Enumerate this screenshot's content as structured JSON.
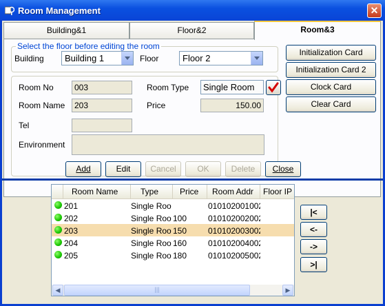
{
  "window": {
    "title": "Room Management"
  },
  "tabs": [
    {
      "label": "Building&1",
      "active": false
    },
    {
      "label": "Floor&2",
      "active": false
    },
    {
      "label": "Room&3",
      "active": true
    }
  ],
  "floor_group": {
    "legend": "Select the floor before editing the room",
    "building_label": "Building",
    "building_value": "Building 1",
    "floor_label": "Floor",
    "floor_value": "Floor 2"
  },
  "room_form": {
    "room_no_label": "Room No",
    "room_no_value": "003",
    "room_type_label": "Room Type",
    "room_type_value": "Single Room",
    "room_name_label": "Room Name",
    "room_name_value": "203",
    "price_label": "Price",
    "price_value": "150.00",
    "tel_label": "Tel",
    "tel_value": "",
    "environment_label": "Environment",
    "environment_value": ""
  },
  "card_buttons": [
    "Initialization Card",
    "Initialization Card 2",
    "Clock Card",
    "Clear Card"
  ],
  "action_buttons": {
    "add": "Add",
    "edit": "Edit",
    "cancel": "Cancel",
    "ok": "OK",
    "delete": "Delete",
    "close": "Close"
  },
  "grid": {
    "columns": [
      "Room Name",
      "Type",
      "Price",
      "Room Addr",
      "Floor IP"
    ],
    "rows": [
      {
        "name": "201",
        "type": "Single Room",
        "price": "",
        "addr": "010102001002",
        "ip": "",
        "selected": false
      },
      {
        "name": "202",
        "type": "Single Room",
        "price": "100",
        "addr": "010102002002",
        "ip": "",
        "selected": false
      },
      {
        "name": "203",
        "type": "Single Room",
        "price": "150",
        "addr": "010102003002",
        "ip": "",
        "selected": true
      },
      {
        "name": "204",
        "type": "Single Room",
        "price": "160",
        "addr": "010102004002",
        "ip": "",
        "selected": false
      },
      {
        "name": "205",
        "type": "Single Room",
        "price": "180",
        "addr": "010102005002",
        "ip": "",
        "selected": false
      }
    ],
    "status_color": "#19c400",
    "selected_color": "#f6ddae"
  },
  "nav_buttons": {
    "first": "|<",
    "prev": "<-",
    "next": "->",
    "last": ">|"
  }
}
